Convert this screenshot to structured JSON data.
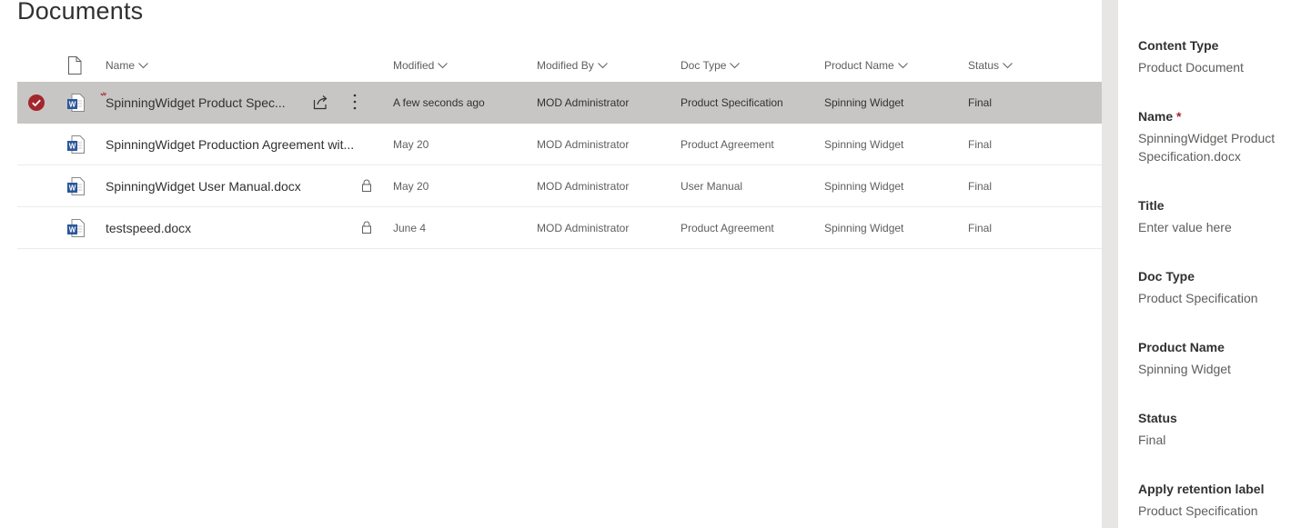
{
  "page": {
    "title": "Documents"
  },
  "columns": {
    "name": "Name",
    "modified": "Modified",
    "modified_by": "Modified By",
    "doc_type": "Doc Type",
    "product_name": "Product Name",
    "status": "Status"
  },
  "rows": [
    {
      "name": "SpinningWidget Product Spec...",
      "modified": "A few seconds ago",
      "modified_by": "MOD Administrator",
      "doc_type": "Product Specification",
      "product_name": "Spinning Widget",
      "status": "Final",
      "selected": true,
      "new": true,
      "locked": false
    },
    {
      "name": "SpinningWidget Production Agreement wit...",
      "modified": "May 20",
      "modified_by": "MOD Administrator",
      "doc_type": "Product Agreement",
      "product_name": "Spinning Widget",
      "status": "Final",
      "selected": false,
      "new": false,
      "locked": false
    },
    {
      "name": "SpinningWidget User Manual.docx",
      "modified": "May 20",
      "modified_by": "MOD Administrator",
      "doc_type": "User Manual",
      "product_name": "Spinning Widget",
      "status": "Final",
      "selected": false,
      "new": false,
      "locked": true
    },
    {
      "name": "testspeed.docx",
      "modified": "June 4",
      "modified_by": "MOD Administrator",
      "doc_type": "Product Agreement",
      "product_name": "Spinning Widget",
      "status": "Final",
      "selected": false,
      "new": false,
      "locked": true
    }
  ],
  "details_panel": {
    "fields": {
      "content_type": {
        "label": "Content Type",
        "value": "Product Document"
      },
      "name": {
        "label": "Name",
        "required_mark": "*",
        "value": "SpinningWidget Product Specification.docx"
      },
      "title": {
        "label": "Title",
        "placeholder": "Enter value here"
      },
      "doc_type": {
        "label": "Doc Type",
        "value": "Product Specification"
      },
      "product_name": {
        "label": "Product Name",
        "value": "Spinning Widget"
      },
      "status": {
        "label": "Status",
        "value": "Final"
      },
      "retention": {
        "label": "Apply retention label",
        "value": "Product Specification"
      }
    }
  },
  "icons": {
    "file_header": "document-icon",
    "row_file": "word-document-icon",
    "selected": "checkmark-circle-icon",
    "new": "new-item-icon",
    "share": "share-icon",
    "more": "more-vertical-icon",
    "lock": "lock-icon"
  },
  "colors": {
    "selected_check": "#a4262c",
    "word_blue": "#2b579a",
    "selected_row": "#c8c6c4",
    "required": "#a4262c"
  }
}
